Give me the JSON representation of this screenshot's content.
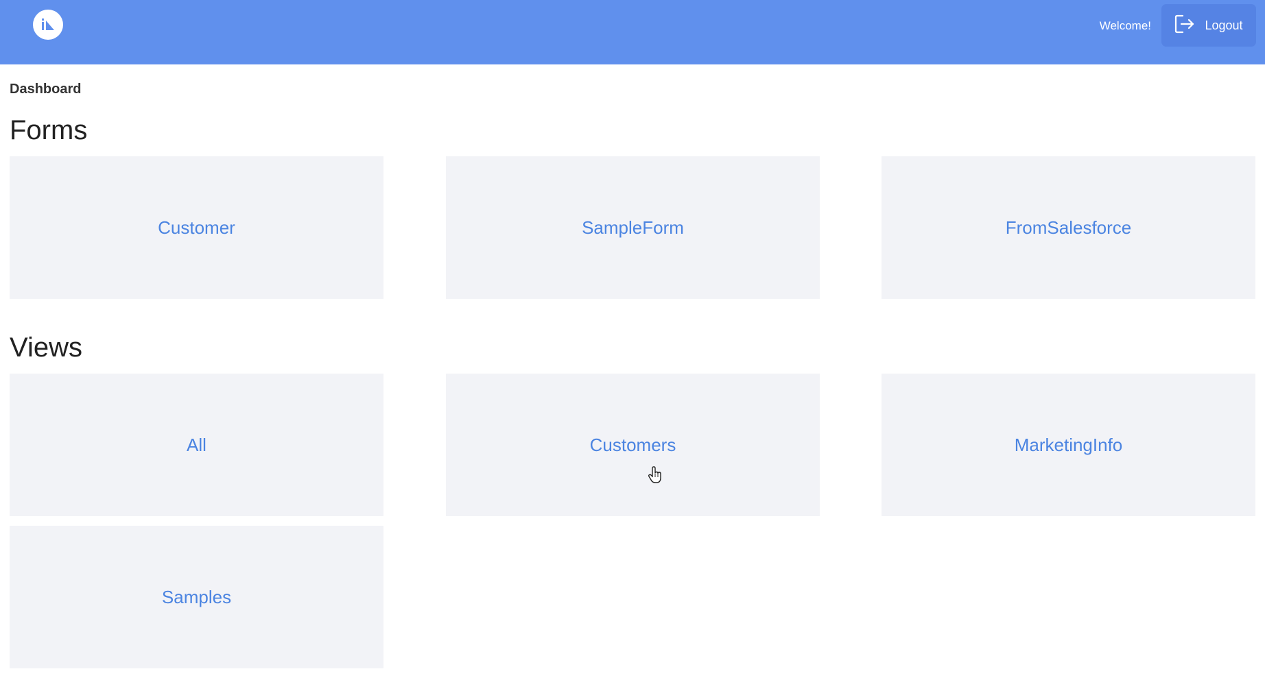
{
  "header": {
    "logo_icon": "app-logo-icon",
    "welcome_text": "Welcome!",
    "logout_label": "Logout",
    "logout_icon": "logout-icon",
    "bar_color": "#6090ed",
    "button_color": "#5583e4"
  },
  "breadcrumb": {
    "label": "Dashboard"
  },
  "sections": {
    "forms": {
      "title": "Forms",
      "cards": [
        {
          "label": "Customer"
        },
        {
          "label": "SampleForm"
        },
        {
          "label": "FromSalesforce"
        }
      ]
    },
    "views": {
      "title": "Views",
      "cards": [
        {
          "label": "All"
        },
        {
          "label": "Customers"
        },
        {
          "label": "MarketingInfo"
        },
        {
          "label": "Samples"
        }
      ]
    }
  },
  "colors": {
    "card_background": "#f2f3f7",
    "link_text": "#4b84e1"
  }
}
